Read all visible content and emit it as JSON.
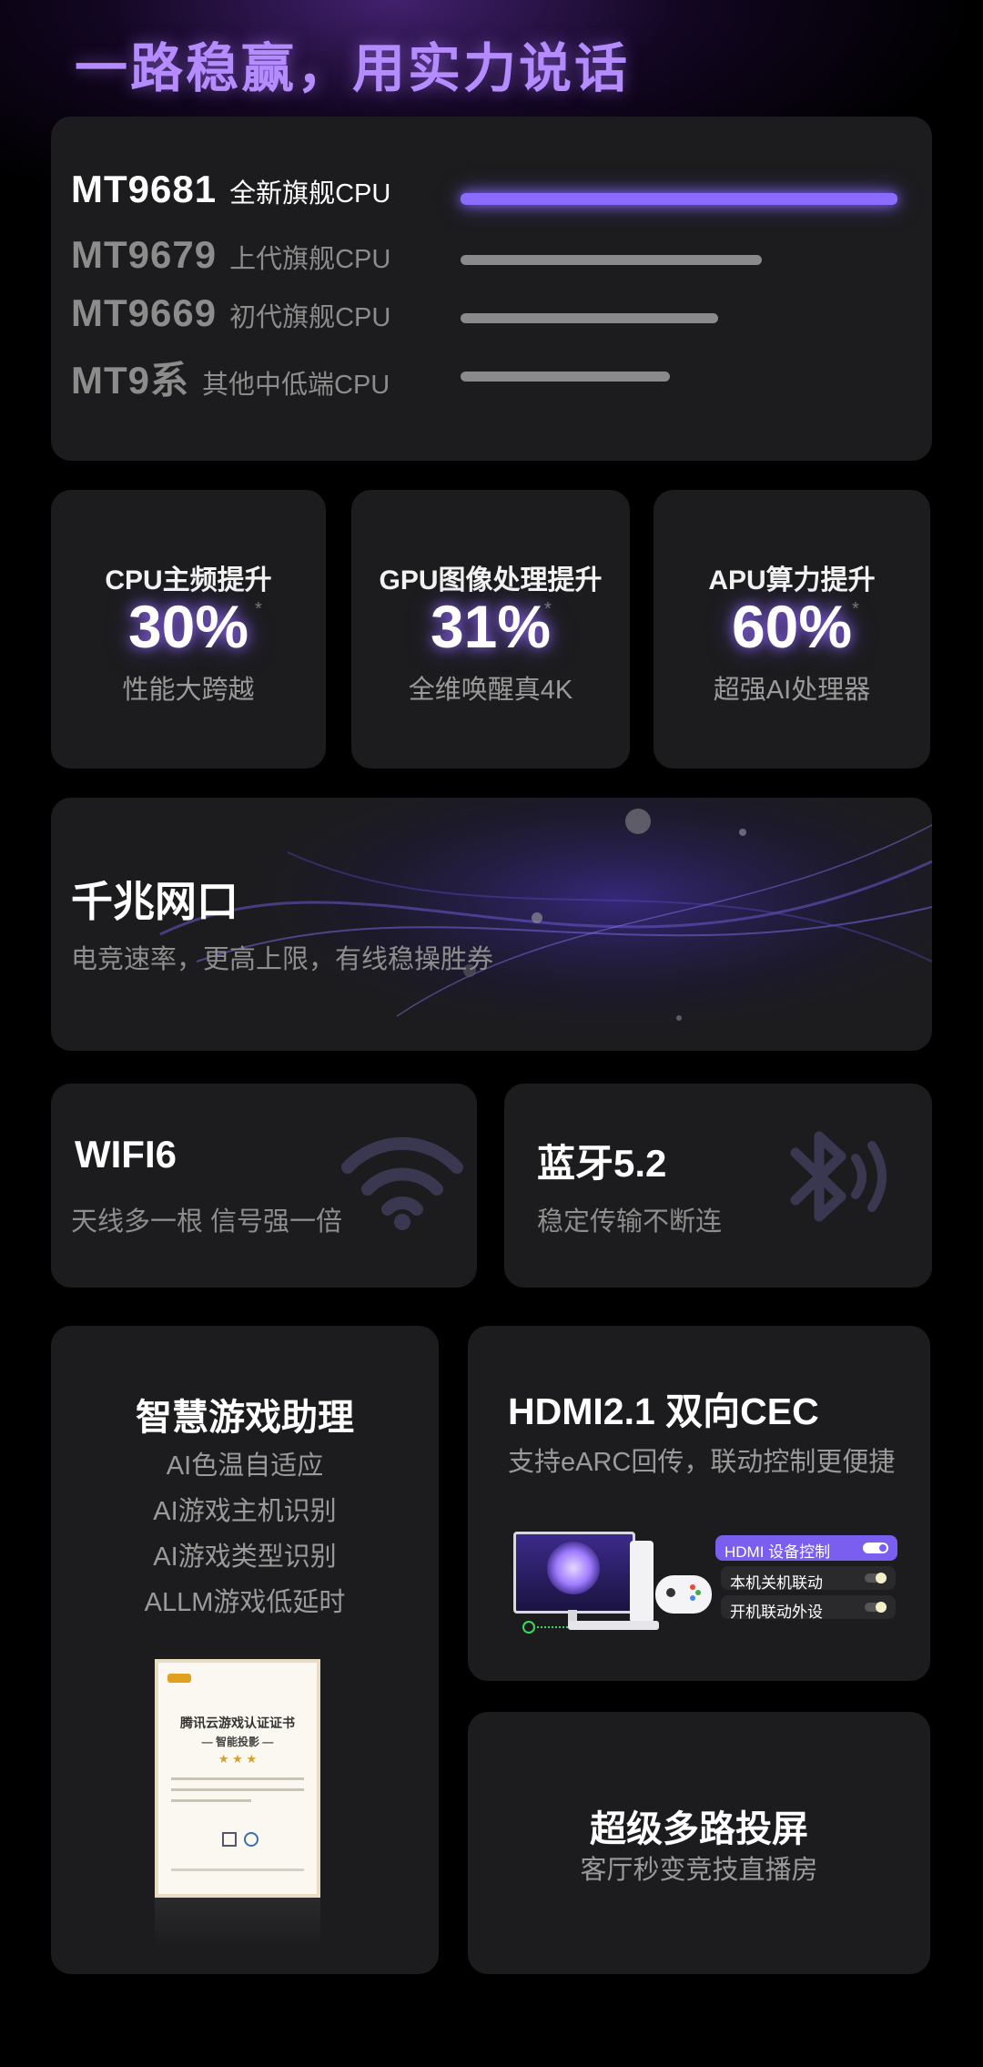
{
  "headline": "一路稳赢，用实力说话",
  "cpu_compare": [
    {
      "model": "MT9681",
      "desc": "全新旗舰CPU",
      "level": 1.0,
      "highlight": true
    },
    {
      "model": "MT9679",
      "desc": "上代旗舰CPU",
      "level": 0.69,
      "highlight": false
    },
    {
      "model": "MT9669",
      "desc": "初代旗舰CPU",
      "level": 0.59,
      "highlight": false
    },
    {
      "model": "MT9系",
      "desc": "其他中低端CPU",
      "level": 0.48,
      "highlight": false
    }
  ],
  "stats": [
    {
      "title": "CPU主频提升",
      "value": "30%",
      "star": "*",
      "sub": "性能大跨越"
    },
    {
      "title": "GPU图像处理提升",
      "value": "31%",
      "star": "*",
      "sub": "全维唤醒真4K"
    },
    {
      "title": "APU算力提升",
      "value": "60%",
      "star": "*",
      "sub": "超强AI处理器"
    }
  ],
  "ethernet": {
    "title": "千兆网口",
    "sub": "电竞速率，更高上限，有线稳操胜券"
  },
  "wifi": {
    "title": "WIFI6",
    "sub": "天线多一根  信号强一倍",
    "icon": "wifi-icon"
  },
  "bluetooth": {
    "title": "蓝牙5.2",
    "sub": "稳定传输不断连",
    "icon": "bluetooth-icon"
  },
  "game_assist": {
    "title": "智慧游戏助理",
    "items": [
      "AI色温自适应",
      "AI游戏主机识别",
      "AI游戏类型识别",
      "ALLM游戏低延时"
    ],
    "cert": {
      "title": "腾讯云游戏认证证书",
      "subtitle": "— 智能投影 —",
      "stars": "★ ★ ★"
    }
  },
  "hdmi": {
    "title": "HDMI2.1 双向CEC",
    "sub": "支持eARC回传，联动控制更便捷",
    "panel": {
      "header": "HDMI 设备控制",
      "options": [
        "本机关机联动",
        "开机联动外设"
      ]
    }
  },
  "cast": {
    "title": "超级多路投屏",
    "sub": "客厅秒变竞技直播房"
  },
  "colors": {
    "accent": "#8b6cff",
    "card": "#1c1c1e",
    "muted": "#8e8e8e"
  }
}
